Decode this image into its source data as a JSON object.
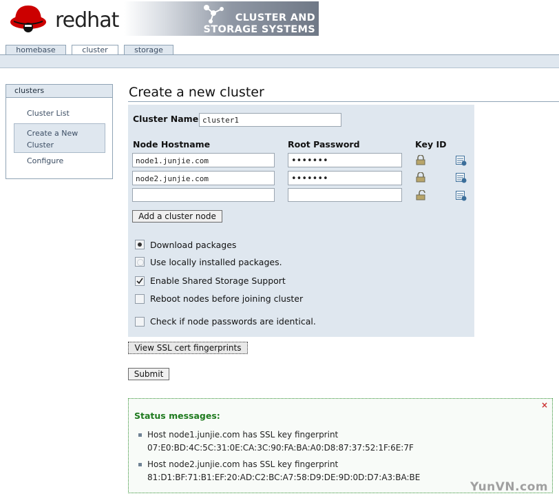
{
  "header": {
    "brand": "redhat",
    "banner_line1": "CLUSTER AND",
    "banner_line2": "STORAGE SYSTEMS"
  },
  "tabs": [
    {
      "label": "homebase",
      "active": false
    },
    {
      "label": "cluster",
      "active": true
    },
    {
      "label": "storage",
      "active": false
    }
  ],
  "sidebar": {
    "title": "clusters",
    "items": [
      "Cluster List",
      "Create a New Cluster",
      "Configure"
    ],
    "selected_line1": "Create a New",
    "selected_line2": "Cluster"
  },
  "page": {
    "title": "Create a new cluster"
  },
  "form": {
    "cluster_name_label": "Cluster Name",
    "cluster_name_value": "cluster1",
    "col_hostname": "Node Hostname",
    "col_password": "Root Password",
    "col_keyid": "Key ID",
    "nodes": [
      {
        "hostname": "node1.junjie.com",
        "password": "•••••••",
        "key_icon": "lock-closed-icon"
      },
      {
        "hostname": "node2.junjie.com",
        "password": "•••••••",
        "key_icon": "lock-closed-icon"
      },
      {
        "hostname": "",
        "password": "",
        "key_icon": "lock-open-icon"
      }
    ],
    "add_node_label": "Add a cluster node",
    "options": {
      "download": {
        "label": "Download packages",
        "selected": true
      },
      "local": {
        "label": "Use locally installed packages.",
        "selected": false
      },
      "shared_storage": {
        "label": "Enable Shared Storage Support",
        "checked": true
      },
      "reboot": {
        "label": "Reboot nodes before joining cluster",
        "checked": false
      },
      "identical": {
        "label": "Check if node passwords are identical.",
        "checked": false
      }
    }
  },
  "buttons": {
    "ssl": "View SSL cert fingerprints",
    "submit": "Submit"
  },
  "status": {
    "close": "×",
    "heading": "Status messages:",
    "messages": [
      {
        "line1": "Host node1.junjie.com has SSL key fingerprint",
        "line2": "07:E0:BD:4C:5C:31:0E:CA:3C:90:FA:BA:A0:D8:87:37:52:1F:6E:7F"
      },
      {
        "line1": "Host node2.junjie.com has SSL key fingerprint",
        "line2": "81:D1:BF:71:B1:EF:20:AD:C2:BC:A7:58:D9:DE:9D:0D:D7:A3:BA:BE"
      }
    ]
  },
  "watermark": "YunVN.com",
  "colors": {
    "brand_red": "#cc0000",
    "panel": "#dfe7ef",
    "border": "#8fa3b5",
    "status_green": "#1e7a1e"
  }
}
